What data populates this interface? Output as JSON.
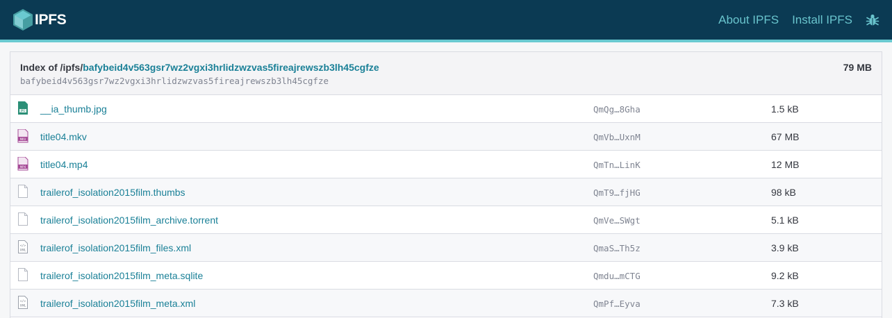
{
  "header": {
    "logo_text": "IPFS",
    "nav": [
      {
        "label": "About IPFS"
      },
      {
        "label": "Install IPFS"
      }
    ],
    "colors": {
      "background": "#0b3a53",
      "link": "#69c4cd",
      "accent": "#6acad1"
    }
  },
  "index": {
    "prefix": "Index of /ipfs/",
    "cid": "bafybeid4v563gsr7wz2vgxi3hrlidzwzvas5fireajrewszb3lh45cgfze",
    "cid_plain": "bafybeid4v563gsr7wz2vgxi3hrlidzwzvas5fireajrewszb3lh45cgfze",
    "total_size": "79 MB"
  },
  "files": [
    {
      "icon": "jpg-file-icon",
      "name": "__ia_thumb.jpg",
      "hash": "QmQg…8Gha",
      "size": "1.5 kB"
    },
    {
      "icon": "mkv-file-icon",
      "name": "title04.mkv",
      "hash": "QmVb…UxnM",
      "size": "67 MB"
    },
    {
      "icon": "mp4-file-icon",
      "name": "title04.mp4",
      "hash": "QmTn…LinK",
      "size": "12 MB"
    },
    {
      "icon": "generic-file-icon",
      "name": "trailerof_isolation2015film.thumbs",
      "hash": "QmT9…fjHG",
      "size": "98 kB"
    },
    {
      "icon": "generic-file-icon",
      "name": "trailerof_isolation2015film_archive.torrent",
      "hash": "QmVe…SWgt",
      "size": "5.1 kB"
    },
    {
      "icon": "xml-file-icon",
      "name": "trailerof_isolation2015film_files.xml",
      "hash": "QmaS…Th5z",
      "size": "3.9 kB"
    },
    {
      "icon": "generic-file-icon",
      "name": "trailerof_isolation2015film_meta.sqlite",
      "hash": "Qmdu…mCTG",
      "size": "9.2 kB"
    },
    {
      "icon": "xml-file-icon",
      "name": "trailerof_isolation2015film_meta.xml",
      "hash": "QmPf…Eyva",
      "size": "7.3 kB"
    }
  ]
}
